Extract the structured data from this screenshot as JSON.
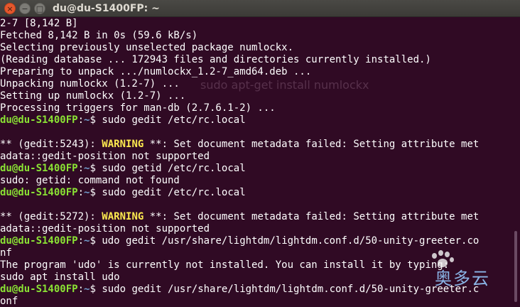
{
  "window": {
    "title": "du@du-S1400FP: ~",
    "close_glyph": "×",
    "minimize_glyph": "−",
    "maximize_glyph": "□"
  },
  "colors": {
    "background": "#300a24",
    "prompt_user": "#8ae234",
    "prompt_path": "#729fcf",
    "warning": "#fce94f",
    "text": "#ffffff"
  },
  "prompt": {
    "user": "du@du-S1400FP",
    "path": "~",
    "symbol": "$"
  },
  "terminal": {
    "lines": [
      {
        "text": "2-7 [8,142 B]"
      },
      {
        "text": "Fetched 8,142 B in 0s (59.6 kB/s)"
      },
      {
        "text": "Selecting previously unselected package numlockx."
      },
      {
        "text": "(Reading database ... 172943 files and directories currently installed.)"
      },
      {
        "text": "Preparing to unpack .../numlockx_1.2-7_amd64.deb ..."
      },
      {
        "text": "Unpacking numlockx (1.2-7) ..."
      },
      {
        "text": "Setting up numlockx (1.2-7) ..."
      },
      {
        "text": "Processing triggers for man-db (2.7.6.1-2) ..."
      },
      {
        "cmd": "sudo gedit /etc/rc.local"
      },
      {
        "text": ""
      },
      {
        "pre": "** (gedit:5243): ",
        "warn": "WARNING",
        "post": " **: Set document metadata failed: Setting attribute met"
      },
      {
        "text": "adata::gedit-position not supported"
      },
      {
        "cmd": "sudo getid /etc/rc.local"
      },
      {
        "text": "sudo: getid: command not found"
      },
      {
        "cmd": "sudo gedit /etc/rc.local"
      },
      {
        "text": ""
      },
      {
        "pre": "** (gedit:5272): ",
        "warn": "WARNING",
        "post": " **: Set document metadata failed: Setting attribute met"
      },
      {
        "text": "adata::gedit-position not supported"
      },
      {
        "cmd": "udo gedit /usr/share/lightdm/lightdm.conf.d/50-unity-greeter.co"
      },
      {
        "text": "nf"
      },
      {
        "text": "The program 'udo' is currently not installed. You can install it by typing:"
      },
      {
        "text": "sudo apt install udo"
      },
      {
        "cmd": "sudo gedit /usr/share/lightdm/lightdm.conf.d/50-unity-greeter.c"
      },
      {
        "text": "onf"
      }
    ]
  },
  "background_overlay": {
    "text": "sudo apt-get install numlockx"
  },
  "watermark": {
    "text": "奥多云"
  }
}
